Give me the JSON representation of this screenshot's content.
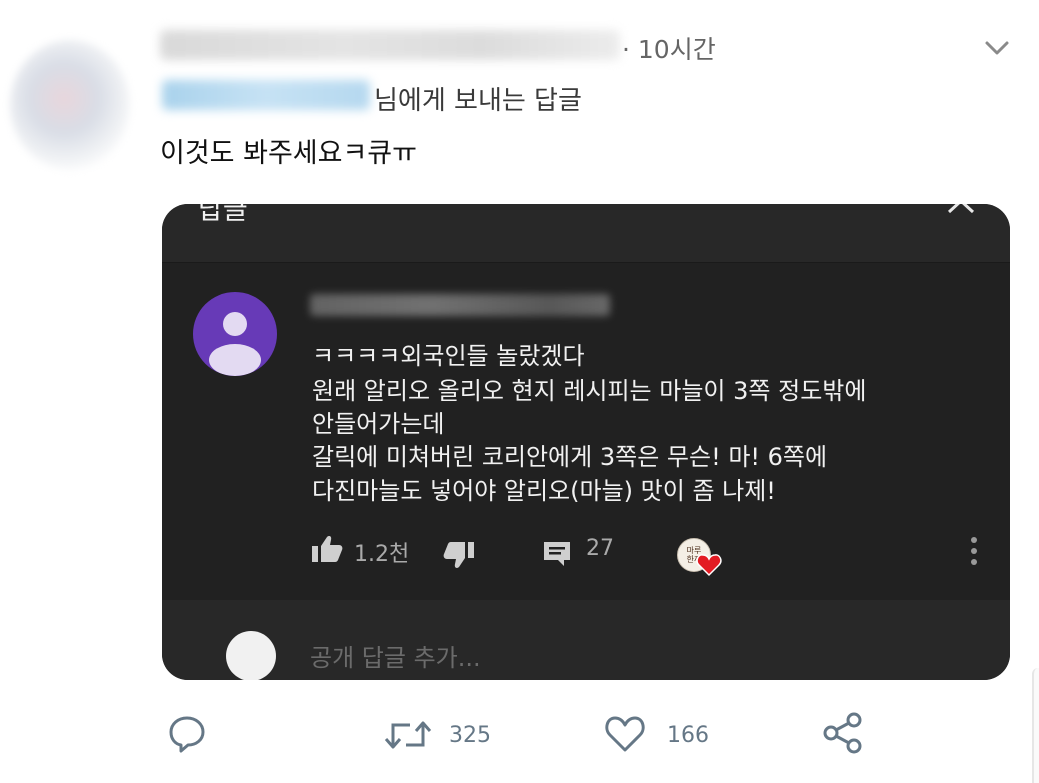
{
  "tweet": {
    "time": "· 10시간",
    "reply_to_suffix": "님에게 보내는 답글",
    "text": "이것도 봐주세요ㅋ큐ㅠ",
    "actions": {
      "retweets": "325",
      "likes": "166"
    },
    "icons": [
      "reply-icon",
      "retweet-icon",
      "heart-icon",
      "share-icon",
      "caret-down-icon"
    ]
  },
  "embedded": {
    "title": "답글",
    "comment": {
      "lines": [
        "ㅋㅋㅋㅋ외국인들 놀랐겠다",
        "원래 알리오 올리오 현지 레시피는 마늘이 3쪽 정도밖에",
        "안들어가는데",
        "갈릭에 미쳐버린 코리안에게 3쪽은 무슨! 마! 6쪽에",
        "다진마늘도 넣어야 알리오(마늘) 맛이 좀 나제!"
      ],
      "likes": "1.2천",
      "replies": "27",
      "creator_badge": "마루 한끼"
    },
    "reply_placeholder": "공개 답글 추가...",
    "colors": {
      "panel": "#212121",
      "avatar": "#673ab7",
      "heart": "#e31b23"
    }
  }
}
